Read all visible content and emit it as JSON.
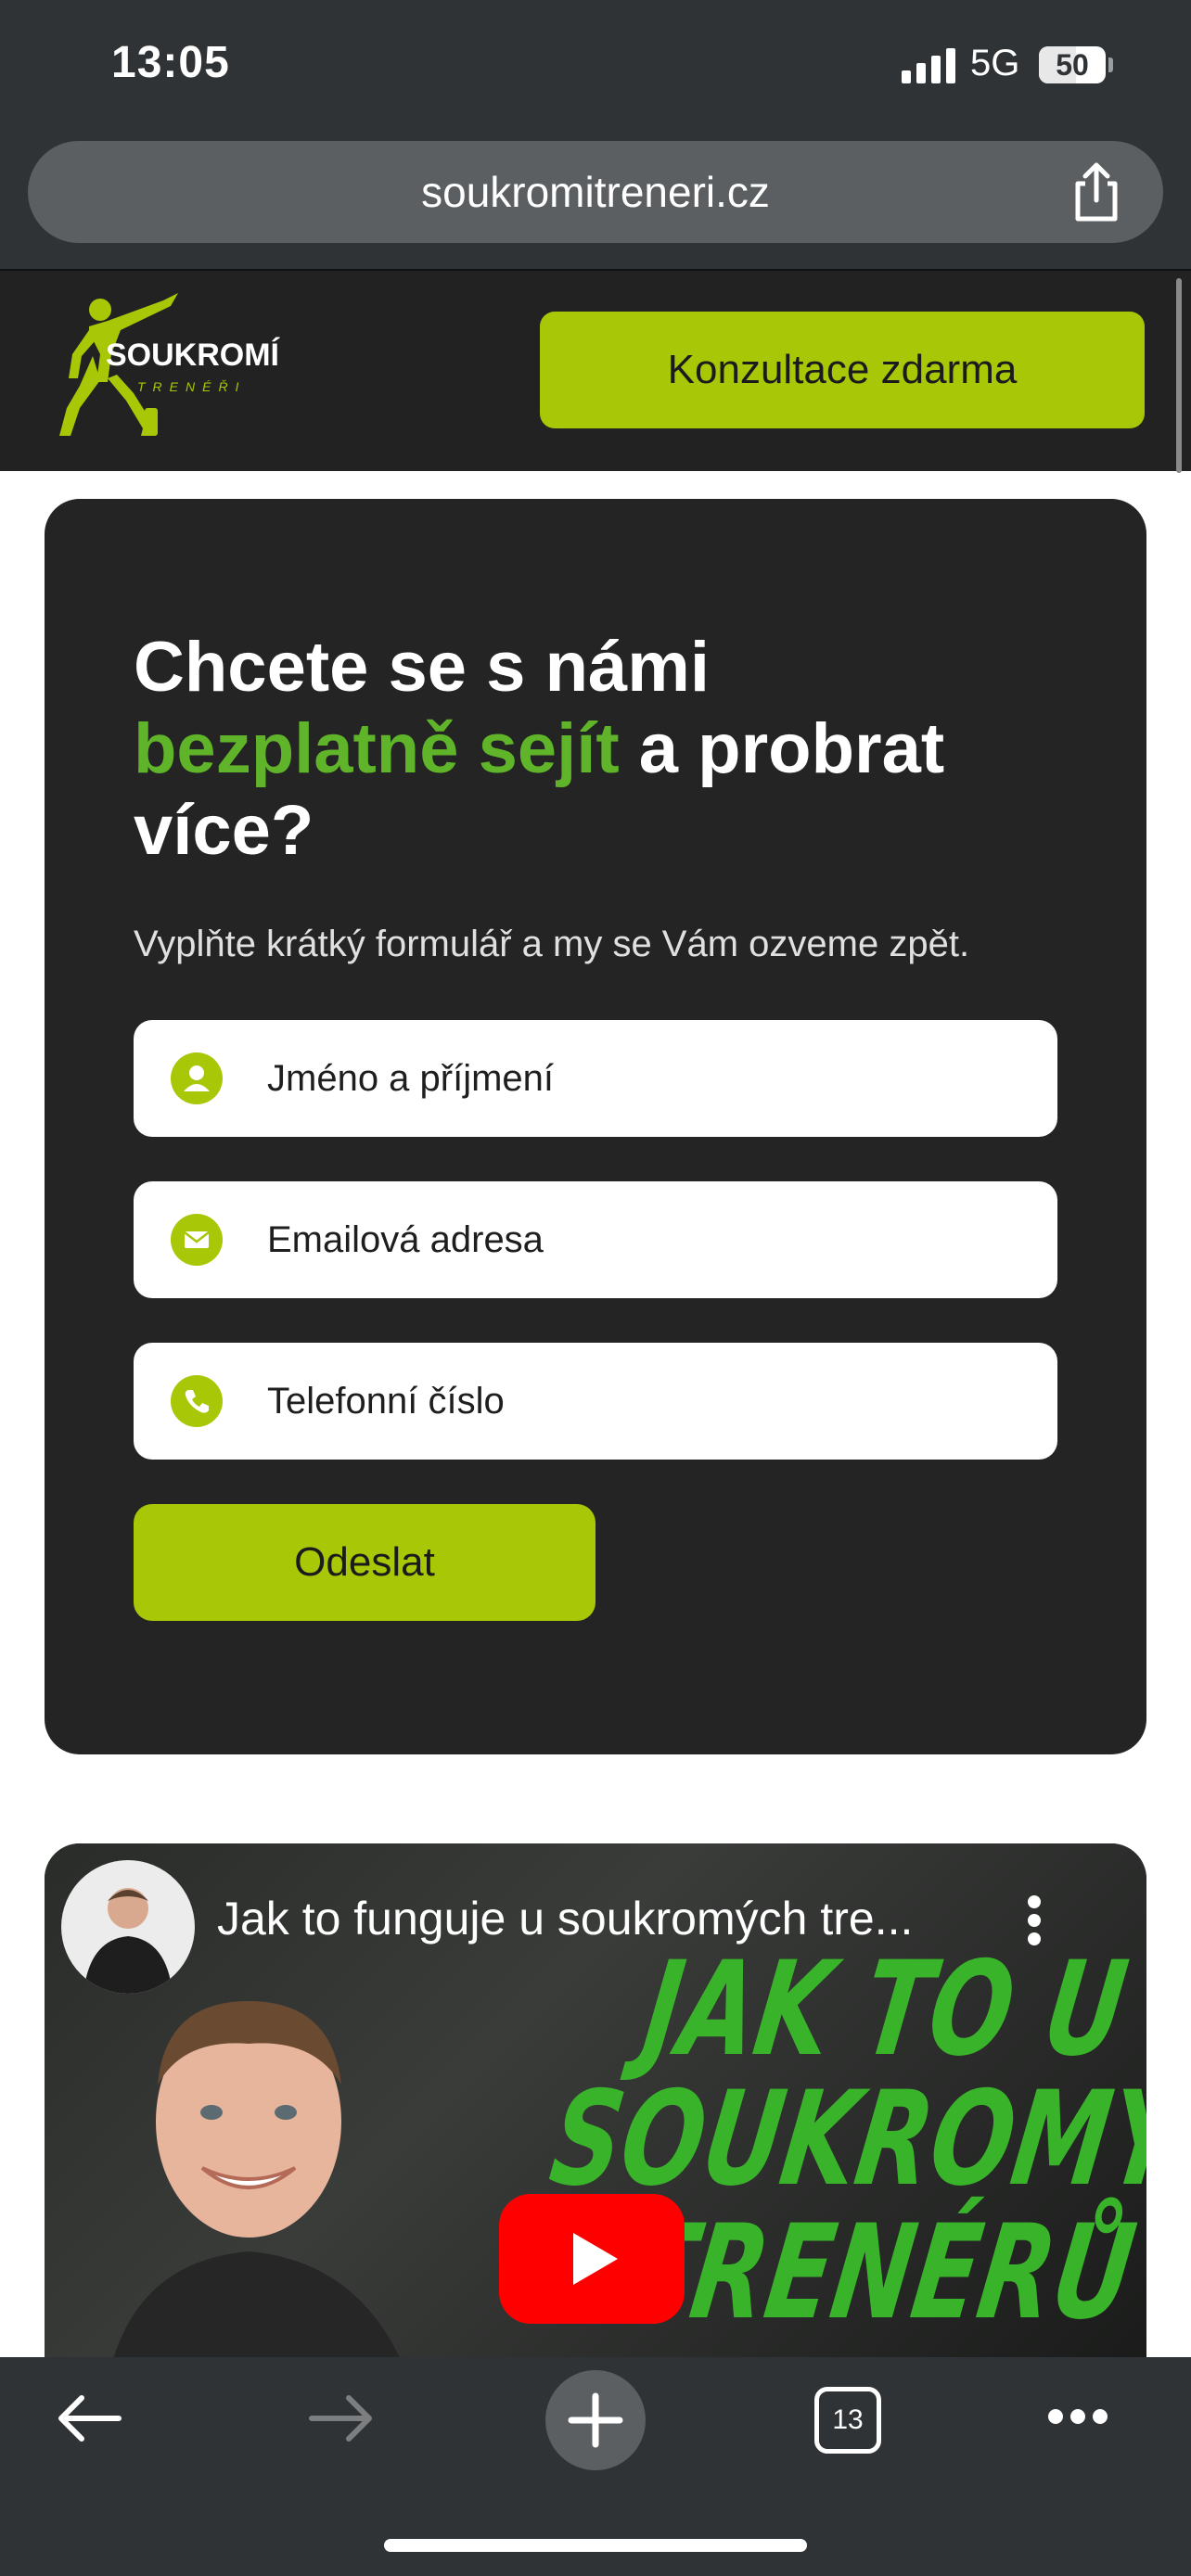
{
  "status_bar": {
    "time": "13:05",
    "network": "5G",
    "battery": "50"
  },
  "browser": {
    "url": "soukromitreneri.cz",
    "tab_count": "13"
  },
  "site_header": {
    "logo_text": "SOUKROMÍ",
    "logo_subtext": "TRENÉŘI",
    "cta_label": "Konzultace zdarma"
  },
  "form": {
    "heading_part1": "Chcete se s námi",
    "heading_accent": "bezplatně sejít",
    "heading_part2": " a probrat",
    "heading_part3": "více?",
    "subtext": "Vyplňte krátký formulář a my se Vám ozveme zpět.",
    "fields": [
      {
        "placeholder": "Jméno a příjmení",
        "icon": "person-icon"
      },
      {
        "placeholder": "Emailová adresa",
        "icon": "envelope-icon"
      },
      {
        "placeholder": "Telefonní číslo",
        "icon": "phone-icon"
      }
    ],
    "submit_label": "Odeslat"
  },
  "video": {
    "title": "Jak to funguje u soukromých tre...",
    "overlay_lines": [
      "JAK TO U",
      "SOUKROMÝCH",
      "TRENÉRŮ"
    ]
  },
  "colors": {
    "accent_lime": "#a8c707",
    "accent_green": "#5fb42a",
    "dark_card": "#242424",
    "chrome_gray": "#303335"
  }
}
